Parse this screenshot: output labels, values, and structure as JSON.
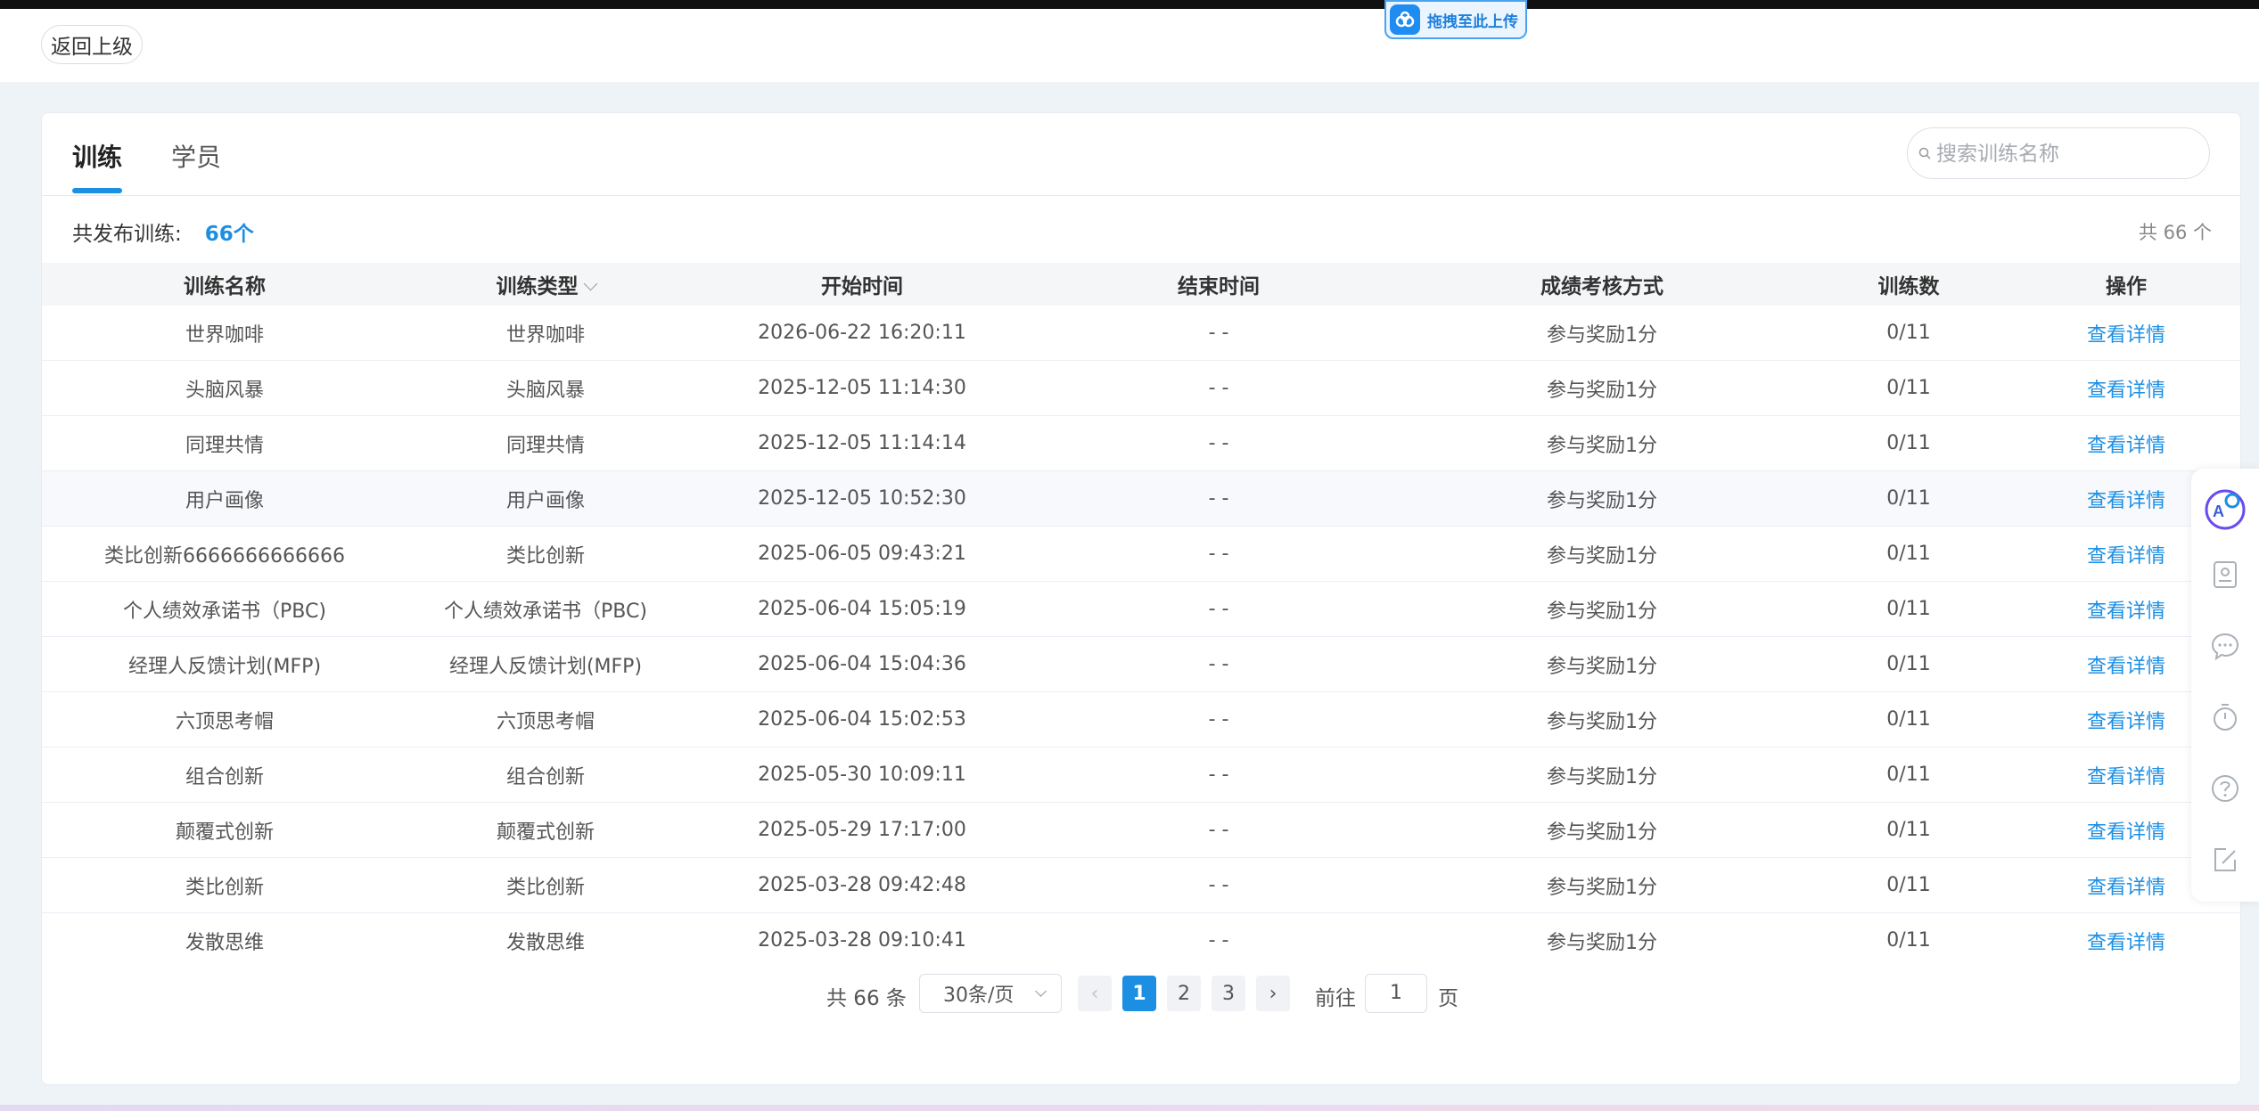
{
  "header": {
    "back_label": "返回上级"
  },
  "upload": {
    "label": "拖拽至此上传"
  },
  "tabs": [
    {
      "label": "训练"
    },
    {
      "label": "学员"
    }
  ],
  "search": {
    "placeholder": "搜索训练名称"
  },
  "summary": {
    "label": "共发布训练:",
    "count": "66个",
    "total_right": "共 66 个"
  },
  "table": {
    "columns": [
      "训练名称",
      "训练类型",
      "开始时间",
      "结束时间",
      "成绩考核方式",
      "训练数",
      "操作"
    ],
    "rows": [
      {
        "name": "世界咖啡",
        "type": "世界咖啡",
        "start": "2026-06-22 16:20:11",
        "end": "- -",
        "method": "参与奖励1分",
        "count": "0/11",
        "action": "查看详情"
      },
      {
        "name": "头脑风暴",
        "type": "头脑风暴",
        "start": "2025-12-05 11:14:30",
        "end": "- -",
        "method": "参与奖励1分",
        "count": "0/11",
        "action": "查看详情"
      },
      {
        "name": "同理共情",
        "type": "同理共情",
        "start": "2025-12-05 11:14:14",
        "end": "- -",
        "method": "参与奖励1分",
        "count": "0/11",
        "action": "查看详情"
      },
      {
        "name": "用户画像",
        "type": "用户画像",
        "start": "2025-12-05 10:52:30",
        "end": "- -",
        "method": "参与奖励1分",
        "count": "0/11",
        "action": "查看详情"
      },
      {
        "name": "类比创新6666666666666",
        "type": "类比创新",
        "start": "2025-06-05 09:43:21",
        "end": "- -",
        "method": "参与奖励1分",
        "count": "0/11",
        "action": "查看详情"
      },
      {
        "name": "个人绩效承诺书（PBC)",
        "type": "个人绩效承诺书（PBC)",
        "start": "2025-06-04 15:05:19",
        "end": "- -",
        "method": "参与奖励1分",
        "count": "0/11",
        "action": "查看详情"
      },
      {
        "name": "经理人反馈计划(MFP)",
        "type": "经理人反馈计划(MFP)",
        "start": "2025-06-04 15:04:36",
        "end": "- -",
        "method": "参与奖励1分",
        "count": "0/11",
        "action": "查看详情"
      },
      {
        "name": "六顶思考帽",
        "type": "六顶思考帽",
        "start": "2025-06-04 15:02:53",
        "end": "- -",
        "method": "参与奖励1分",
        "count": "0/11",
        "action": "查看详情"
      },
      {
        "name": "组合创新",
        "type": "组合创新",
        "start": "2025-05-30 10:09:11",
        "end": "- -",
        "method": "参与奖励1分",
        "count": "0/11",
        "action": "查看详情"
      },
      {
        "name": "颠覆式创新",
        "type": "颠覆式创新",
        "start": "2025-05-29 17:17:00",
        "end": "- -",
        "method": "参与奖励1分",
        "count": "0/11",
        "action": "查看详情"
      },
      {
        "name": "类比创新",
        "type": "类比创新",
        "start": "2025-03-28 09:42:48",
        "end": "- -",
        "method": "参与奖励1分",
        "count": "0/11",
        "action": "查看详情"
      },
      {
        "name": "发散思维",
        "type": "发散思维",
        "start": "2025-03-28 09:10:41",
        "end": "- -",
        "method": "参与奖励1分",
        "count": "0/11",
        "action": "查看详情"
      }
    ]
  },
  "pagination": {
    "total": "共 66 条",
    "page_size": "30条/页",
    "prev": "‹",
    "pages": [
      "1",
      "2",
      "3"
    ],
    "current": "1",
    "next": "›",
    "goto_label": "前往",
    "goto_value": "1",
    "page_label": "页"
  },
  "sidebar_icons": [
    "ai-assistant-icon",
    "contact-card-icon",
    "chat-icon",
    "timer-icon",
    "help-icon",
    "edit-icon"
  ],
  "colors": {
    "accent": "#1d8fe3",
    "background": "#eef3f8"
  }
}
